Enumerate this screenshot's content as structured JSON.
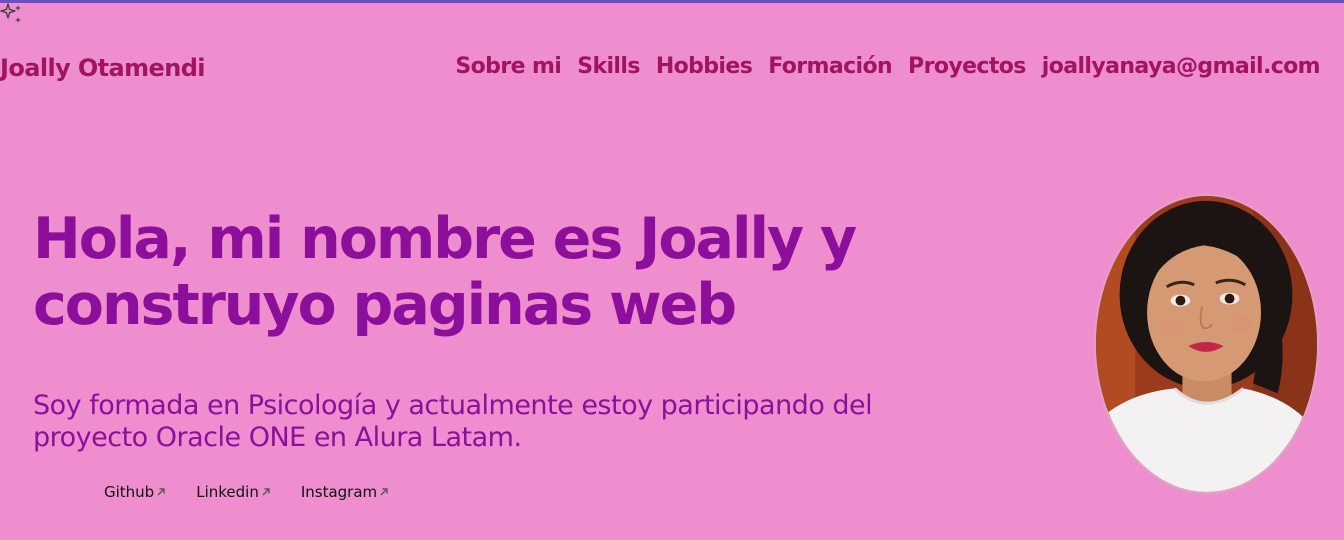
{
  "brand": {
    "name": "Joally Otamendi"
  },
  "nav": {
    "items": [
      {
        "label": "Sobre mi"
      },
      {
        "label": "Skills"
      },
      {
        "label": "Hobbies"
      },
      {
        "label": "Formación"
      },
      {
        "label": "Proyectos"
      },
      {
        "label": "joallyanaya@gmail.com"
      }
    ]
  },
  "hero": {
    "title_line1": "Hola, mi nombre es Joally y",
    "title_line2": "construyo paginas web",
    "subtitle_line1": "Soy formada en Psicología y actualmente estoy participando del",
    "subtitle_line2": "proyecto Oracle ONE en Alura Latam."
  },
  "social": {
    "links": [
      {
        "label": "Github"
      },
      {
        "label": "Linkedin"
      },
      {
        "label": "Instagram"
      }
    ]
  },
  "icons": {
    "sparkle": "sparkle-icon",
    "external_link": "external-arrow-icon"
  },
  "colors": {
    "background": "#ef8ecf",
    "nav_text": "#a01460",
    "hero_text": "#8b0f9a",
    "top_rule": "#6a4fc4"
  }
}
